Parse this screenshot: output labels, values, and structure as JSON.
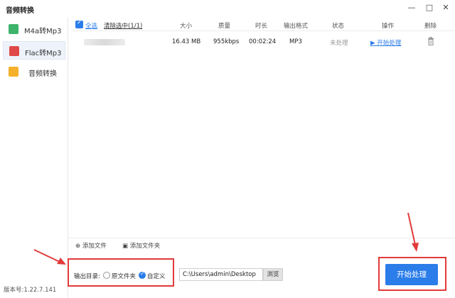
{
  "window": {
    "title": "音频转换",
    "minimize": "—",
    "maximize": "□",
    "close": "✕"
  },
  "sidebar": {
    "items": [
      {
        "label": "M4a转Mp3",
        "icon": "m4a-file-icon",
        "color": "#3db36b"
      },
      {
        "label": "Flac转Mp3",
        "icon": "flac-file-icon",
        "color": "#e04848"
      },
      {
        "label": "音频转换",
        "icon": "audio-file-icon",
        "color": "#f5b12b"
      }
    ],
    "version": "版本号:1.22.7.141"
  },
  "table": {
    "select_all": "全选",
    "clear_selected": "清除选中(1/1)",
    "headers": {
      "size": "大小",
      "quality": "质量",
      "duration": "时长",
      "format": "输出格式",
      "status": "状态",
      "action": "操作",
      "delete": "删除"
    },
    "rows": [
      {
        "size": "16.43 MB",
        "quality": "955kbps",
        "duration": "00:02:24",
        "format": "MP3",
        "status": "未处理",
        "action": "▶ 开始处理"
      }
    ]
  },
  "toolbar": {
    "add_file": "添加文件",
    "add_folder": "添加文件夹"
  },
  "output": {
    "label": "输出目录:",
    "option_original": "原文件夹",
    "option_custom": "自定义",
    "path": "C:\\Users\\admin\\Desktop",
    "browse": "浏览"
  },
  "start_button": "开始处理",
  "colors": {
    "accent": "#2b7de9",
    "highlight": "#e23a3a"
  }
}
